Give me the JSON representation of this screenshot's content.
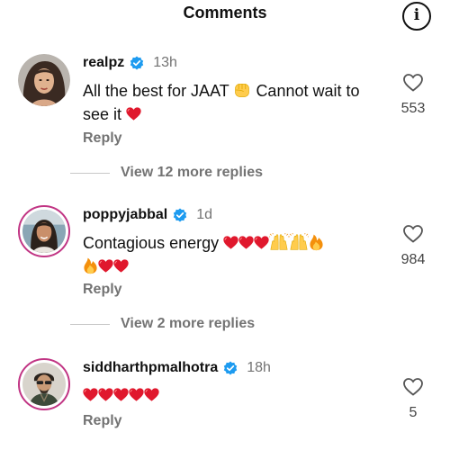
{
  "header": {
    "title": "Comments",
    "info_icon_label": "i"
  },
  "comments": [
    {
      "username": "realpz",
      "verified": true,
      "time": "13h",
      "text": "All the best for JAAT",
      "text_mid": "Cannot wait to see it",
      "reply_label": "Reply",
      "likes": "553",
      "view_replies": "View 12 more replies"
    },
    {
      "username": "poppyjabbal",
      "verified": true,
      "time": "1d",
      "text": "Contagious energy",
      "reply_label": "Reply",
      "likes": "984",
      "view_replies": "View 2 more replies"
    },
    {
      "username": "siddharthpmalhotra",
      "verified": true,
      "time": "18h",
      "text": "",
      "reply_label": "Reply",
      "likes": "5"
    }
  ],
  "icons": {
    "heart_outline": "heart-icon",
    "verified_badge": "verified-badge-icon",
    "info": "info-icon"
  },
  "colors": {
    "verified_blue": "#1d9bf0",
    "secondary_text": "#737373",
    "emoji_red": "#e0182d",
    "story_ring": "#c13584"
  }
}
